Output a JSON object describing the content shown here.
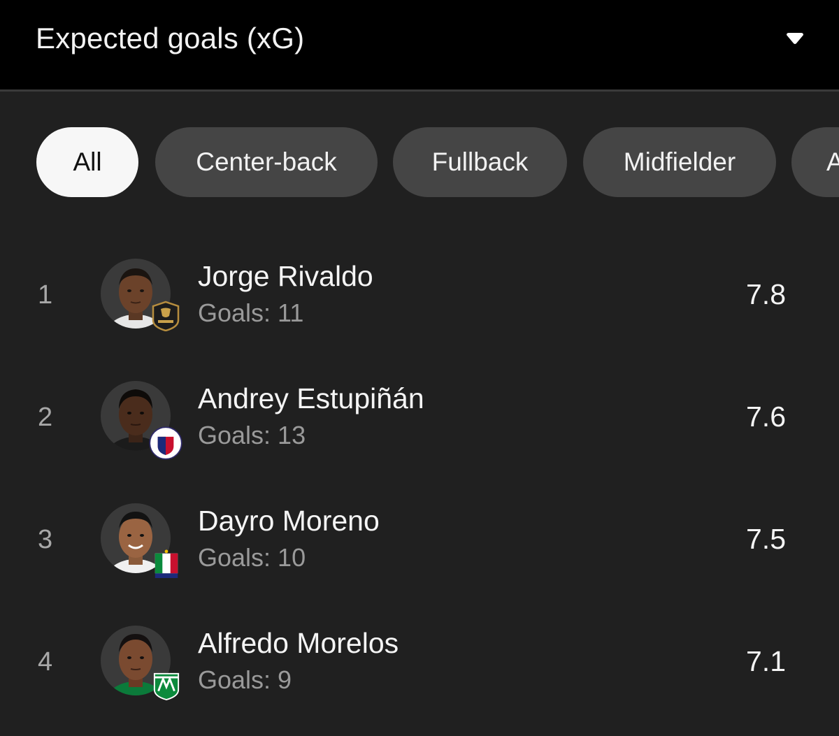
{
  "header": {
    "title": "Expected goals (xG)",
    "dropdown_icon": "caret-down-icon"
  },
  "filters": [
    {
      "label": "All",
      "selected": true
    },
    {
      "label": "Center-back",
      "selected": false
    },
    {
      "label": "Fullback",
      "selected": false
    },
    {
      "label": "Midfielder",
      "selected": false
    },
    {
      "label": "A",
      "selected": false
    }
  ],
  "players": [
    {
      "rank": "1",
      "name": "Jorge Rivaldo",
      "goals": "Goals: 11",
      "value": "7.8",
      "avatar_icon": "player-photo",
      "club_icon": "club-badge-aguilas-doradas"
    },
    {
      "rank": "2",
      "name": "Andrey Estupiñán",
      "goals": "Goals: 13",
      "value": "7.6",
      "avatar_icon": "player-photo",
      "club_icon": "club-badge-deportivo-pasto"
    },
    {
      "rank": "3",
      "name": "Dayro Moreno",
      "goals": "Goals: 10",
      "value": "7.5",
      "avatar_icon": "player-photo",
      "club_icon": "club-badge-once-caldas"
    },
    {
      "rank": "4",
      "name": "Alfredo Morelos",
      "goals": "Goals: 9",
      "value": "7.1",
      "avatar_icon": "player-photo",
      "club_icon": "club-badge-atletico-nacional"
    }
  ],
  "colors": {
    "background": "#202020",
    "header_background": "#000000",
    "chip_background": "#454545",
    "chip_selected_background": "#f7f7f7",
    "secondary_text": "#9a9a9a"
  }
}
